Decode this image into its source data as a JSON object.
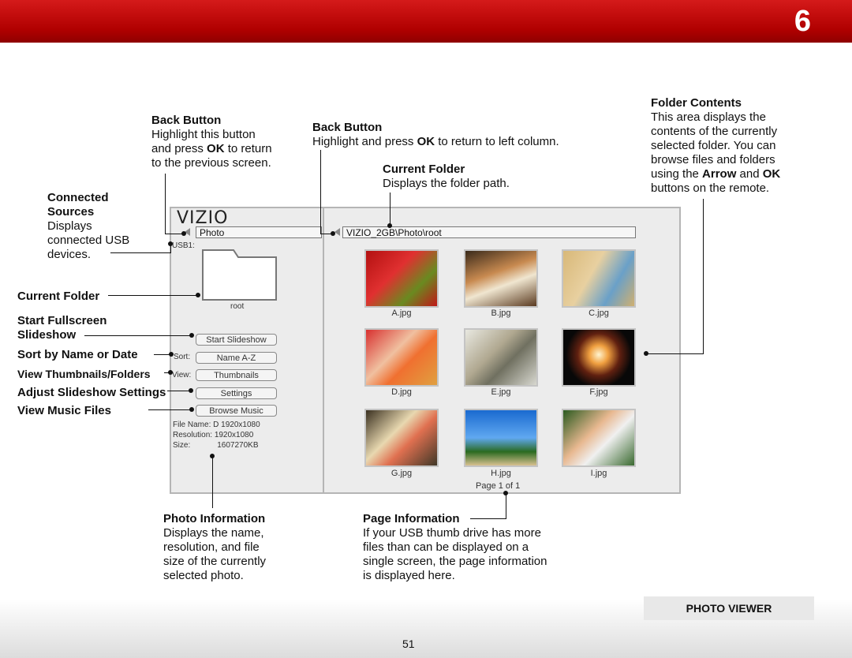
{
  "header": {
    "chapter_number": "6",
    "bar_color": "#c00000"
  },
  "annotations": {
    "back_left": {
      "title": "Back Button",
      "l1": "Highlight this button",
      "l2a": "and press ",
      "l2b": "OK",
      "l2c": " to return",
      "l3": "to the previous screen."
    },
    "back_right": {
      "title": "Back Button",
      "l1a": "Highlight and press ",
      "l1b": "OK",
      "l1c": " to return to left column."
    },
    "current_folder_top": {
      "title": "Current Folder",
      "l1": "Displays the folder path."
    },
    "folder_contents": {
      "title": "Folder Contents",
      "l1": "This area displays the",
      "l2": "contents of the currently",
      "l3": "selected folder. You can",
      "l4": "browse files and folders",
      "l5a": "using the ",
      "l5b": "Arrow",
      "l5c": " and ",
      "l5d": "OK",
      "l6": "buttons on the remote."
    },
    "connected_sources": {
      "t1": "Connected",
      "t2": "Sources",
      "l1": "Displays",
      "l2": "connected USB",
      "l3": "devices."
    },
    "photo_info": {
      "title": "Photo Information",
      "l1": "Displays the name,",
      "l2": "resolution, and file",
      "l3": "size of the currently",
      "l4": "selected photo."
    },
    "page_info": {
      "title": "Page Information",
      "l1": "If your USB thumb drive has more",
      "l2": "files than can be displayed on a",
      "l3": "single screen, the page information",
      "l4": "is displayed here."
    }
  },
  "left_labels": {
    "current_folder": "Current Folder",
    "start_fullscreen_1": "Start Fullscreen",
    "start_fullscreen_2": "Slideshow",
    "sort": "Sort by Name or Date",
    "view": "View Thumbnails/Folders",
    "settings": "Adjust Slideshow Settings",
    "music": "View Music Files"
  },
  "screen": {
    "logo": "VIZIO",
    "left_path": "Photo",
    "right_path": "VIZIO_2GB\\Photo\\root",
    "usb_label": "USB1:",
    "folder_name": "root",
    "start_slideshow": "Start Slideshow",
    "sort_label": "Sort:",
    "sort_value": "Name A-Z",
    "view_label": "View:",
    "view_value": "Thumbnails",
    "settings": "Settings",
    "browse_music": "Browse Music",
    "file_info": {
      "name_label": "File Name:",
      "name_value": "D 1920x1080",
      "res_label": "Resolution:",
      "res_value": "1920x1080",
      "size_label": "Size:",
      "size_value": "1607270KB"
    },
    "thumbnails": [
      "A.jpg",
      "B.jpg",
      "C.jpg",
      "D.jpg",
      "E.jpg",
      "F.jpg",
      "G.jpg",
      "H.jpg",
      "I.jpg"
    ],
    "page_indicator": "Page 1 of 1"
  },
  "footer": {
    "section": "PHOTO VIEWER",
    "page_number": "51"
  }
}
